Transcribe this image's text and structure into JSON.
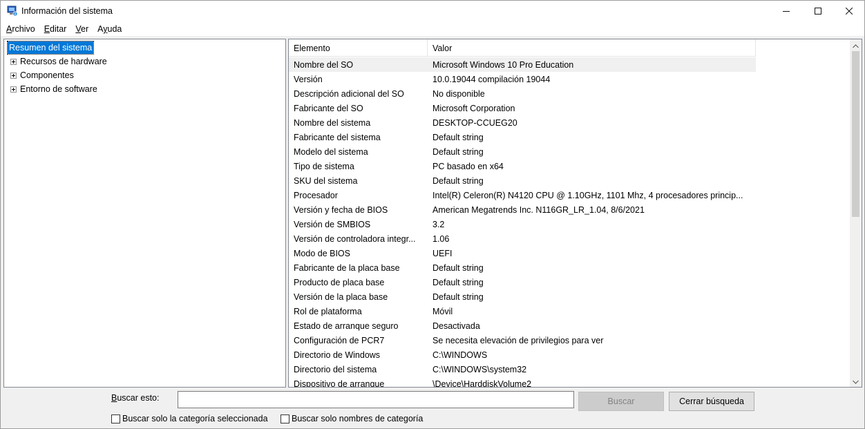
{
  "window": {
    "title": "Información del sistema",
    "controls": {
      "minimize": "minimize-icon",
      "maximize": "maximize-icon",
      "close": "close-icon"
    }
  },
  "menu": [
    {
      "label": "Archivo",
      "accel": "A",
      "rest": "rchivo"
    },
    {
      "label": "Editar",
      "accel": "E",
      "rest": "ditar"
    },
    {
      "label": "Ver",
      "accel": "V",
      "rest": "er"
    },
    {
      "label": "Ayuda",
      "accel": "y",
      "pre": "A",
      "rest": "uda"
    }
  ],
  "tree": {
    "root": "Resumen del sistema",
    "children": [
      "Recursos de hardware",
      "Componentes",
      "Entorno de software"
    ]
  },
  "list": {
    "columns": [
      "Elemento",
      "Valor"
    ],
    "rows": [
      [
        "Nombre del SO",
        "Microsoft Windows 10 Pro Education"
      ],
      [
        "Versión",
        "10.0.19044 compilación 19044"
      ],
      [
        "Descripción adicional del SO",
        "No disponible"
      ],
      [
        "Fabricante del SO",
        "Microsoft Corporation"
      ],
      [
        "Nombre del sistema",
        "DESKTOP-CCUEG20"
      ],
      [
        "Fabricante del sistema",
        "Default string"
      ],
      [
        "Modelo del sistema",
        "Default string"
      ],
      [
        "Tipo de sistema",
        "PC basado en x64"
      ],
      [
        "SKU del sistema",
        "Default string"
      ],
      [
        "Procesador",
        "Intel(R) Celeron(R) N4120 CPU @ 1.10GHz, 1101 Mhz, 4 procesadores princip..."
      ],
      [
        "Versión y fecha de BIOS",
        "American Megatrends Inc. N116GR_LR_1.04, 8/6/2021"
      ],
      [
        "Versión de SMBIOS",
        "3.2"
      ],
      [
        "Versión de controladora integr...",
        "1.06"
      ],
      [
        "Modo de BIOS",
        "UEFI"
      ],
      [
        "Fabricante de la placa base",
        "Default string"
      ],
      [
        "Producto de placa base",
        "Default string"
      ],
      [
        "Versión de la placa base",
        "Default string"
      ],
      [
        "Rol de plataforma",
        "Móvil"
      ],
      [
        "Estado de arranque seguro",
        "Desactivada"
      ],
      [
        "Configuración de PCR7",
        "Se necesita elevación de privilegios para ver"
      ],
      [
        "Directorio de Windows",
        "C:\\WINDOWS"
      ],
      [
        "Directorio del sistema",
        "C:\\WINDOWS\\system32"
      ],
      [
        "Dispositivo de arranque",
        "\\Device\\HarddiskVolume2"
      ]
    ]
  },
  "search": {
    "label": "Buscar esto:",
    "value": "",
    "find_button": "Buscar",
    "clear_button": "Cerrar búsqueda",
    "checkbox_selected_category": "Buscar solo la categoría seleccionada",
    "checkbox_category_names": "Buscar solo nombres de categoría"
  },
  "colors": {
    "selection": "#0078d7",
    "row_highlight": "#f0f0f0",
    "border": "#828790"
  }
}
